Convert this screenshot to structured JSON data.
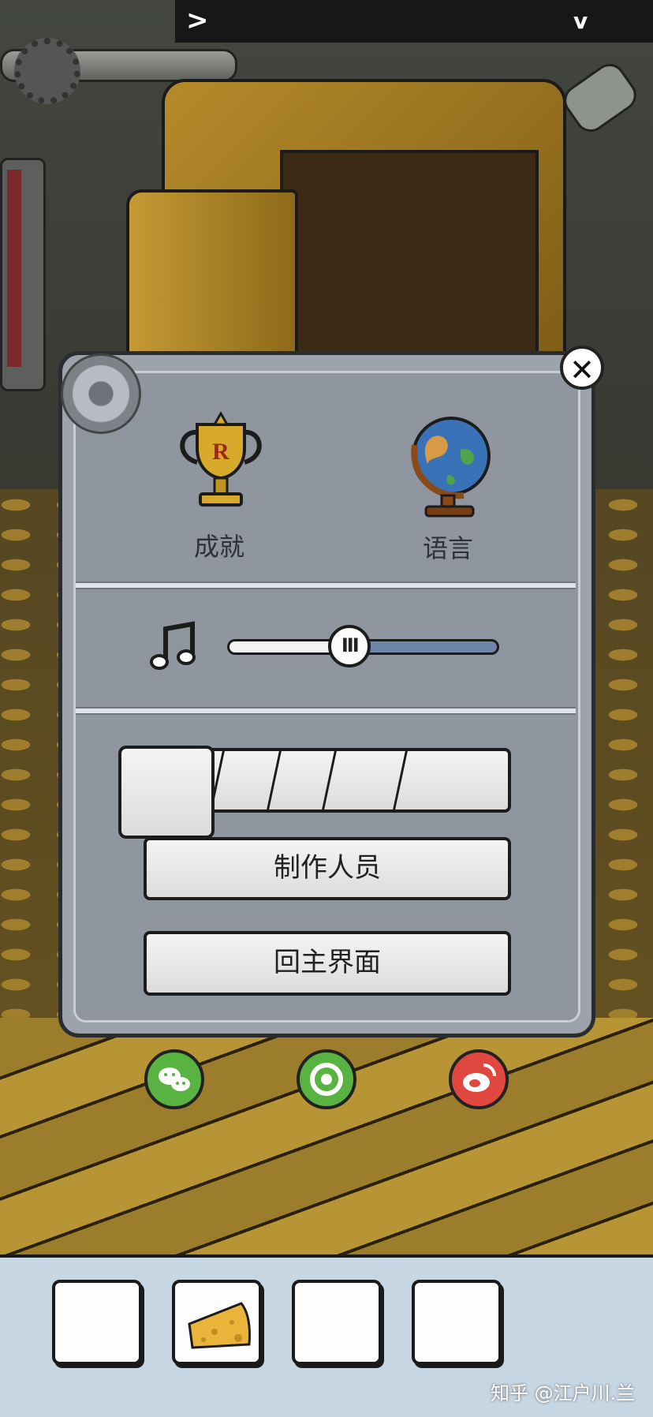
{
  "top_bar": {
    "back_glyph": ">",
    "down_glyph": "v"
  },
  "menu": {
    "achievements_label": "成就",
    "language_label": "语言",
    "music_volume_fraction": 0.45,
    "credits_label": "制作人员",
    "main_menu_label": "回主界面"
  },
  "share": {
    "wechat_color": "#58b340",
    "moments_color": "#58b340",
    "weibo_color": "#e0483f"
  },
  "inventory": {
    "slots": [
      "empty",
      "cheese",
      "empty",
      "empty"
    ]
  },
  "watermark": "知乎 @江户川.兰"
}
